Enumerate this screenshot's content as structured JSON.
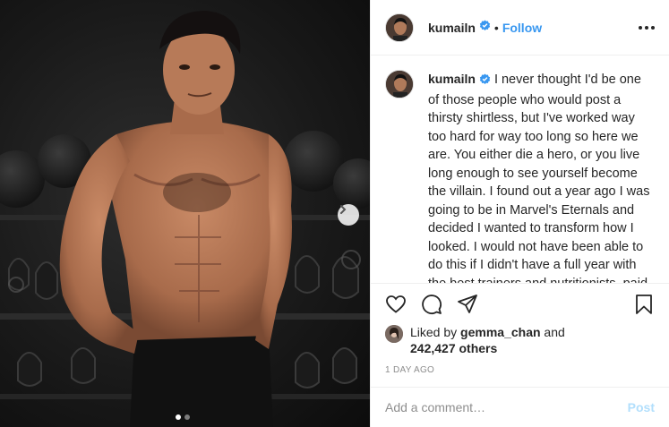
{
  "post": {
    "username": "kumailn",
    "follow_label": "Follow",
    "separator": "•",
    "caption": "I never thought I'd be one of those people who would post a thirsty shirtless, but I've worked way too hard for way too long so here we are. You either die a hero, or you live long enough to see yourself become the villain. I found out a year ago I was going to be in Marvel's Eternals and decided I wanted to transform how I looked. I would not have been able to do this if I didn't have a full year with the best trainers and nutritionists, paid for by the biggest",
    "likes": {
      "prefix": "Liked by",
      "liker": "gemma_chan",
      "conjunction": "and",
      "others": "242,427 others"
    },
    "date": "1 DAY AGO",
    "comment_placeholder": "Add a comment…",
    "post_label": "Post",
    "carousel": {
      "slides": 2,
      "current": 1
    }
  },
  "icons": {
    "verified": "verified-badge-icon",
    "more": "more-options-icon",
    "like": "heart-icon",
    "comment": "comment-bubble-icon",
    "share": "paper-plane-icon",
    "save": "bookmark-icon",
    "next": "chevron-right-icon"
  },
  "colors": {
    "accent": "#3897f0",
    "post_disabled": "#b2dffc",
    "meta": "#8e8e8e",
    "divider": "#efefef"
  }
}
